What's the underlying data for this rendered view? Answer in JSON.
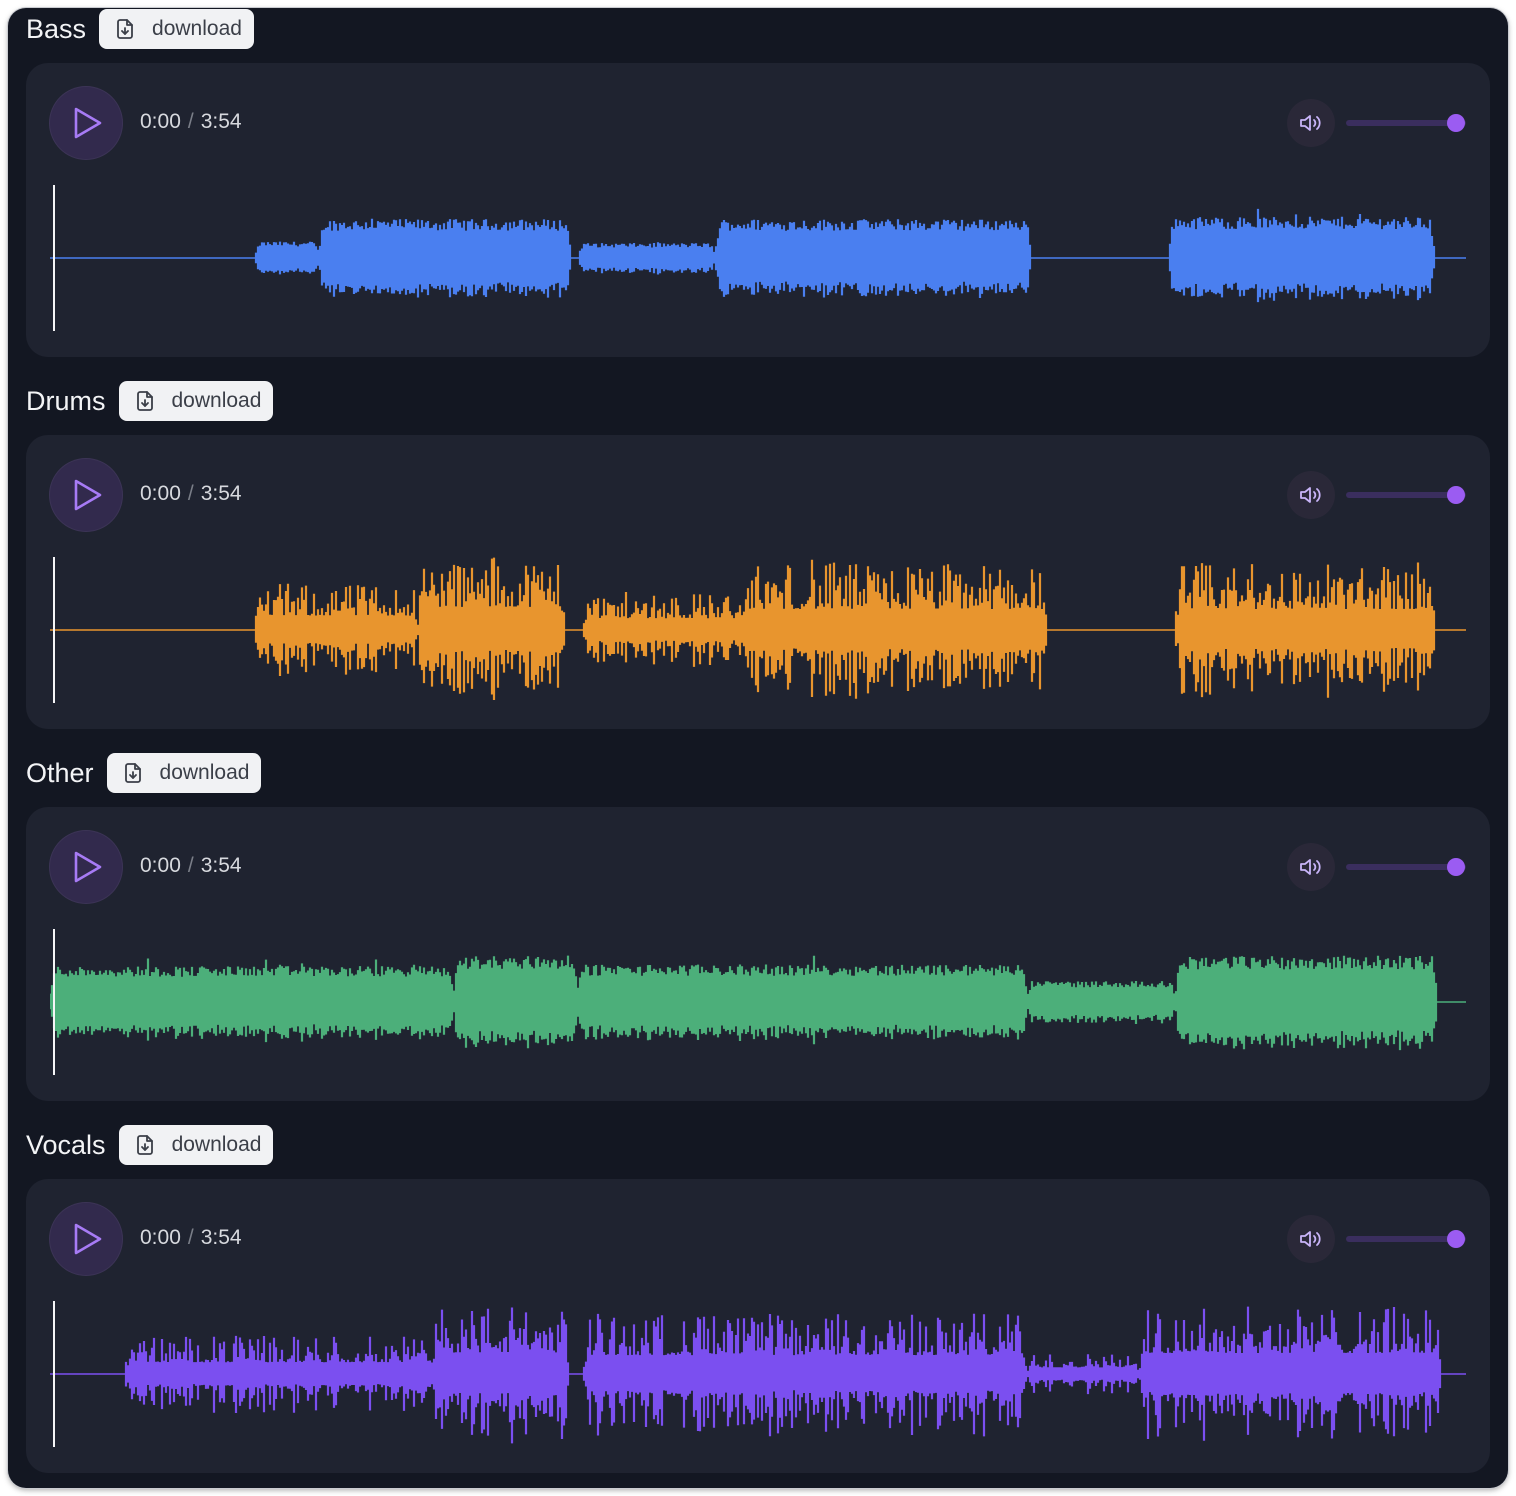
{
  "download_label": "download",
  "accent_color": "#9b5cf2",
  "stems": [
    {
      "name": "Bass",
      "current_time": "0:00",
      "duration": "3:54",
      "volume": 1.0,
      "waveform_color": "#4a7ff0",
      "shape": {
        "segments": [
          [
            0.145,
            0.19,
            0.22
          ],
          [
            0.19,
            0.368,
            0.52
          ],
          [
            0.373,
            0.47,
            0.2
          ],
          [
            0.47,
            0.693,
            0.52
          ],
          [
            0.79,
            0.978,
            0.55
          ]
        ]
      }
    },
    {
      "name": "Drums",
      "current_time": "0:00",
      "duration": "3:54",
      "volume": 1.0,
      "waveform_color": "#e8952e",
      "shape": {
        "segments": [
          [
            0.145,
            0.26,
            0.55
          ],
          [
            0.26,
            0.364,
            0.88
          ],
          [
            0.376,
            0.49,
            0.45
          ],
          [
            0.49,
            0.704,
            0.8
          ],
          [
            0.795,
            0.978,
            0.8
          ]
        ]
      }
    },
    {
      "name": "Other",
      "current_time": "0:00",
      "duration": "3:54",
      "volume": 1.0,
      "waveform_color": "#4caf7a",
      "shape": {
        "segments": [
          [
            0.0,
            0.285,
            0.48
          ],
          [
            0.285,
            0.373,
            0.62
          ],
          [
            0.373,
            0.69,
            0.5
          ],
          [
            0.69,
            0.795,
            0.28
          ],
          [
            0.795,
            0.98,
            0.62
          ]
        ]
      }
    },
    {
      "name": "Vocals",
      "current_time": "0:00",
      "duration": "3:54",
      "volume": 1.0,
      "waveform_color": "#7b4ff0",
      "shape": {
        "segments": [
          [
            0.053,
            0.27,
            0.45
          ],
          [
            0.27,
            0.367,
            0.82
          ],
          [
            0.377,
            0.69,
            0.72
          ],
          [
            0.69,
            0.77,
            0.25
          ],
          [
            0.77,
            0.983,
            0.8
          ]
        ]
      }
    }
  ]
}
